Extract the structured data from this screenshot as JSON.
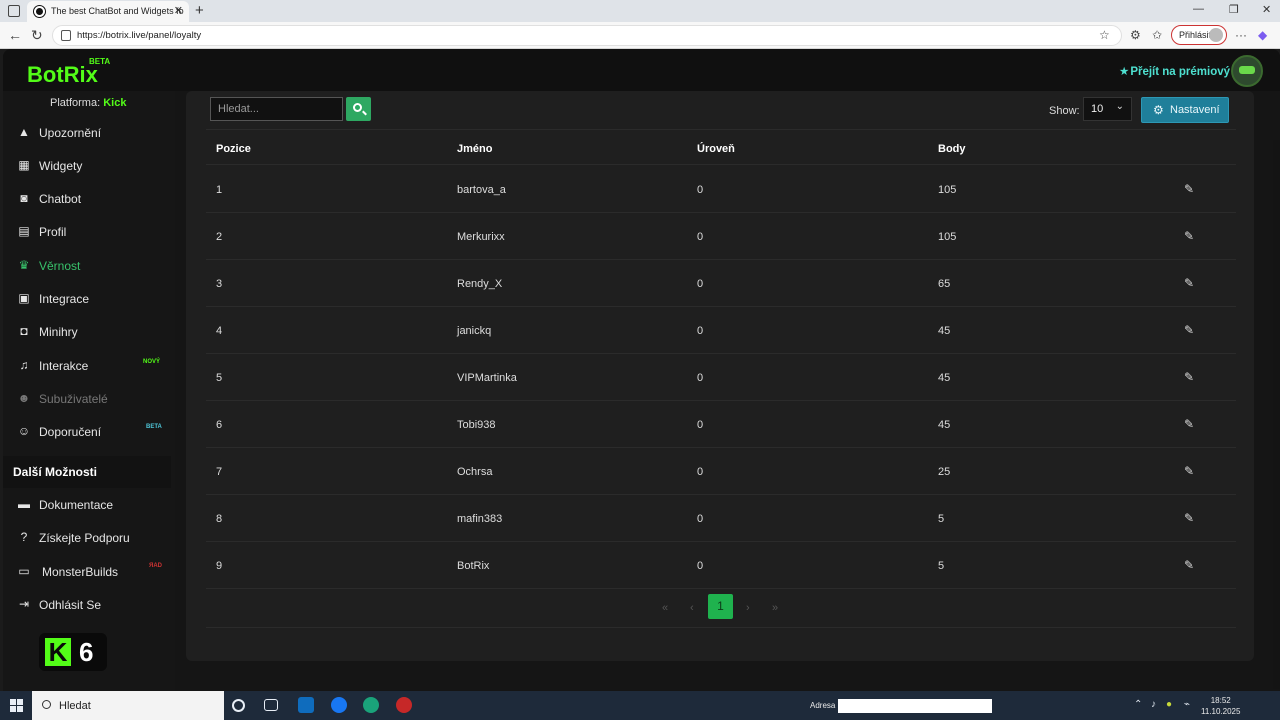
{
  "browser": {
    "tab_title": "The best ChatBot and Widgets fo",
    "url": "https://botrix.live/panel/loyalty",
    "signin_label": "Přihlásit"
  },
  "header": {
    "logo": "BotRix",
    "logo_badge": "BETA",
    "premium_label": "Přejít na prémiový"
  },
  "sidebar": {
    "platform_label": "Platforma:",
    "platform_value": "Kick",
    "items": [
      {
        "label": "Upozornění",
        "icon": "warning-icon"
      },
      {
        "label": "Widgety",
        "icon": "grid-icon"
      },
      {
        "label": "Chatbot",
        "icon": "robot-icon"
      },
      {
        "label": "Profil",
        "icon": "id-card-icon"
      },
      {
        "label": "Věrnost",
        "icon": "trophy-icon"
      },
      {
        "label": "Integrace",
        "icon": "integration-icon"
      },
      {
        "label": "Minihry",
        "icon": "gamepad-icon"
      },
      {
        "label": "Interakce",
        "icon": "music-icon",
        "badge": "NOVÝ"
      },
      {
        "label": "Subuživatelé",
        "icon": "users-icon"
      },
      {
        "label": "Doporučení",
        "icon": "user-friends-icon",
        "badge": "BETA"
      }
    ],
    "section_title": "Další Možnosti",
    "more_items": [
      {
        "label": "Dokumentace",
        "icon": "book-icon"
      },
      {
        "label": "Získejte Podporu",
        "icon": "question-icon"
      },
      {
        "label": "MonsterBuilds",
        "icon": "laptop-icon",
        "badge": "ЯAD"
      },
      {
        "label": "Odhlásit Se",
        "icon": "logout-icon"
      }
    ],
    "kick_badge_number": "6"
  },
  "toolbar": {
    "search_placeholder": "Hledat...",
    "show_label": "Show:",
    "show_value": "10",
    "settings_label": "Nastavení"
  },
  "table": {
    "headers": [
      "Pozice",
      "Jméno",
      "Úroveň",
      "Body"
    ],
    "rows": [
      [
        "1",
        "bartova_a",
        "0",
        "105"
      ],
      [
        "2",
        "Merkurixx",
        "0",
        "105"
      ],
      [
        "3",
        "Rendy_X",
        "0",
        "65"
      ],
      [
        "4",
        "janickq",
        "0",
        "45"
      ],
      [
        "5",
        "VIPMartinka",
        "0",
        "45"
      ],
      [
        "6",
        "Tobi938",
        "0",
        "45"
      ],
      [
        "7",
        "Ochrsa",
        "0",
        "25"
      ],
      [
        "8",
        "mafin383",
        "0",
        "5"
      ],
      [
        "9",
        "BotRix",
        "0",
        "5"
      ]
    ]
  },
  "pagination": {
    "first": "«",
    "prev": "‹",
    "current": "1",
    "next": "›",
    "last": "»"
  },
  "taskbar": {
    "search_label": "Hledat",
    "address_label": "Adresa",
    "time": "18:52",
    "date": "11.10.2025"
  },
  "colors": {
    "accent_green": "#53fc18",
    "active_nav": "#38c36b",
    "settings_button": "#1f7f9a",
    "premium": "#4ee0d0"
  }
}
